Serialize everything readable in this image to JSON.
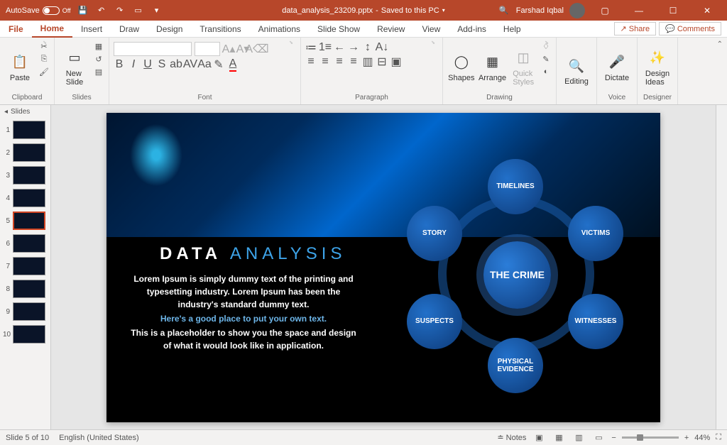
{
  "titlebar": {
    "autosave": "AutoSave",
    "autosave_state": "Off",
    "filename": "data_analysis_23209.pptx",
    "save_status": "Saved to this PC",
    "username": "Farshad Iqbal"
  },
  "tabs": {
    "file": "File",
    "home": "Home",
    "insert": "Insert",
    "draw": "Draw",
    "design": "Design",
    "transitions": "Transitions",
    "animations": "Animations",
    "slideshow": "Slide Show",
    "review": "Review",
    "view": "View",
    "addins": "Add-ins",
    "help": "Help",
    "share": "Share",
    "comments": "Comments"
  },
  "ribbon": {
    "clipboard": {
      "label": "Clipboard",
      "paste": "Paste"
    },
    "slides": {
      "label": "Slides",
      "new_slide": "New\nSlide"
    },
    "font": {
      "label": "Font"
    },
    "paragraph": {
      "label": "Paragraph"
    },
    "drawing": {
      "label": "Drawing",
      "shapes": "Shapes",
      "arrange": "Arrange",
      "quick_styles": "Quick\nStyles"
    },
    "editing": {
      "label": "Editing"
    },
    "voice": {
      "label": "Voice",
      "dictate": "Dictate"
    },
    "designer": {
      "label": "Designer",
      "ideas": "Design\nIdeas"
    }
  },
  "panel": {
    "header": "Slides",
    "count": 10,
    "selected": 5
  },
  "slide": {
    "title_a": "DATA",
    "title_b": "ANALYSIS",
    "body1": "Lorem Ipsum is simply dummy text of the printing and typesetting industry. Lorem Ipsum has been the industry's standard dummy text.",
    "body2": "Here's a good place to put your own text.",
    "body3": "This is a placeholder to show you the space and design of what it would look like in application.",
    "center": "THE CRIME",
    "nodes": [
      "TIMELINES",
      "VICTIMS",
      "WITNESSES",
      "PHYSICAL EVIDENCE",
      "SUSPECTS",
      "STORY"
    ]
  },
  "statusbar": {
    "slide_info": "Slide 5 of 10",
    "language": "English (United States)",
    "notes": "Notes",
    "zoom": "44%"
  }
}
